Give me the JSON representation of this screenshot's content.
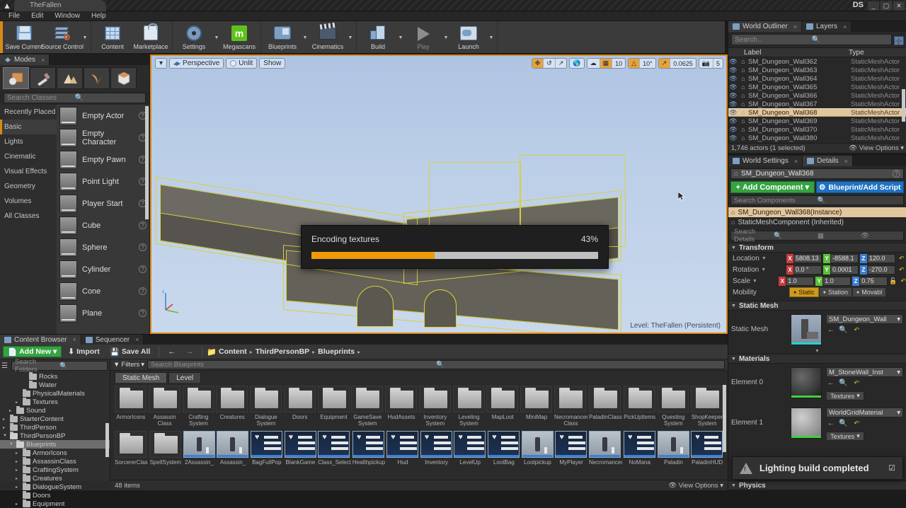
{
  "window": {
    "project_tab": "TheFallen",
    "ds_badge": "DS",
    "buttons": {
      "minimize": "_",
      "maximize": "▢",
      "close": "✕"
    }
  },
  "menubar": [
    "File",
    "Edit",
    "Window",
    "Help"
  ],
  "toolbar": {
    "groups": [
      {
        "items": [
          {
            "label": "Save Current",
            "icon": "save-icon",
            "caret": false
          },
          {
            "label": "Source Control",
            "icon": "source-control-icon",
            "caret": true
          }
        ]
      },
      {
        "items": [
          {
            "label": "Content",
            "icon": "content-icon",
            "caret": false
          },
          {
            "label": "Marketplace",
            "icon": "marketplace-icon",
            "caret": false
          }
        ]
      },
      {
        "items": [
          {
            "label": "Settings",
            "icon": "gear-icon",
            "caret": true
          },
          {
            "label": "Megascans",
            "icon": "megascans-icon",
            "caret": false
          }
        ]
      },
      {
        "items": [
          {
            "label": "Blueprints",
            "icon": "blueprints-icon",
            "caret": true
          },
          {
            "label": "Cinematics",
            "icon": "cinematics-icon",
            "caret": true
          }
        ]
      },
      {
        "items": [
          {
            "label": "Build",
            "icon": "build-icon",
            "caret": true
          },
          {
            "label": "Play",
            "icon": "play-icon",
            "caret": true,
            "disabled": true
          },
          {
            "label": "Launch",
            "icon": "launch-icon",
            "caret": true
          }
        ]
      }
    ]
  },
  "modes": {
    "tab_label": "Modes",
    "close_label": "×",
    "mode_buttons": [
      "place-mode-icon",
      "paint-mode-icon",
      "landscape-mode-icon",
      "foliage-mode-icon",
      "geometry-editing-icon"
    ],
    "search_placeholder": "Search Classes",
    "categories": [
      {
        "label": "Recently Placed",
        "selected": false
      },
      {
        "label": "Basic",
        "selected": true
      },
      {
        "label": "Lights",
        "selected": false
      },
      {
        "label": "Cinematic",
        "selected": false
      },
      {
        "label": "Visual Effects",
        "selected": false
      },
      {
        "label": "Geometry",
        "selected": false
      },
      {
        "label": "Volumes",
        "selected": false
      },
      {
        "label": "All Classes",
        "selected": false
      }
    ],
    "items": [
      {
        "label": "Empty Actor"
      },
      {
        "label": "Empty Character"
      },
      {
        "label": "Empty Pawn"
      },
      {
        "label": "Point Light"
      },
      {
        "label": "Player Start"
      },
      {
        "label": "Cube"
      },
      {
        "label": "Sphere"
      },
      {
        "label": "Cylinder"
      },
      {
        "label": "Cone"
      },
      {
        "label": "Plane"
      }
    ]
  },
  "viewport": {
    "menu_caret": "▾",
    "perspective": "Perspective",
    "view_mode": "Unlit",
    "show": "Show",
    "level_label": "Level:  TheFallen (Persistent)",
    "transform_tools": [
      "translate-tool-icon",
      "rotate-tool-icon",
      "scale-tool-icon"
    ],
    "coord_icon": "world-coordinate-icon",
    "surface_snap_icon": "surface-snap-icon",
    "grid_snap_icon": "grid-snap-icon",
    "grid_snap_value": "10",
    "rotation_snap_icon": "rotation-snap-icon",
    "rotation_snap_value": "10°",
    "scale_snap_icon": "scale-snap-icon",
    "scale_snap_value": "0.0625",
    "camera_speed_icon": "camera-speed-icon",
    "camera_speed_value": "5"
  },
  "progress": {
    "title": "Encoding textures",
    "percent_label": "43%",
    "percent": 43,
    "fill_color": "#f09a0a",
    "track_color": "#c0c0c0"
  },
  "outliner": {
    "tabs": [
      {
        "label": "World Outliner",
        "icon": "outliner-icon",
        "active": true
      },
      {
        "label": "Layers",
        "icon": "layers-icon",
        "active": false
      }
    ],
    "search_placeholder": "Search...",
    "add_button_icon": "add-outliner-icon",
    "columns": [
      "Label",
      "Type"
    ],
    "sort_indicator": "▲",
    "rows": [
      {
        "label": "SM_Dungeon_Wall362",
        "type": "StaticMeshActor",
        "selected": false
      },
      {
        "label": "SM_Dungeon_Wall363",
        "type": "StaticMeshActor",
        "selected": false
      },
      {
        "label": "SM_Dungeon_Wall364",
        "type": "StaticMeshActor",
        "selected": false
      },
      {
        "label": "SM_Dungeon_Wall365",
        "type": "StaticMeshActor",
        "selected": false
      },
      {
        "label": "SM_Dungeon_Wall366",
        "type": "StaticMeshActor",
        "selected": false
      },
      {
        "label": "SM_Dungeon_Wall367",
        "type": "StaticMeshActor",
        "selected": false
      },
      {
        "label": "SM_Dungeon_Wall368",
        "type": "StaticMeshActor",
        "selected": true
      },
      {
        "label": "SM_Dungeon_Wall369",
        "type": "StaticMeshActor",
        "selected": false
      },
      {
        "label": "SM_Dungeon_Wall370",
        "type": "StaticMeshActor",
        "selected": false
      },
      {
        "label": "SM_Dungeon_Wall380",
        "type": "StaticMeshActor",
        "selected": false
      }
    ],
    "status": "1,746 actors (1 selected)",
    "view_options": "View Options"
  },
  "details": {
    "tabs": [
      {
        "label": "World Settings",
        "icon": "world-settings-icon",
        "active": false
      },
      {
        "label": "Details",
        "icon": "details-icon",
        "active": true
      }
    ],
    "actor_name": "SM_Dungeon_Wall368",
    "add_component_label": "Add Component",
    "add_component_plus": "+",
    "add_component_caret": "▾",
    "blueprint_label": "Blueprint/Add Script",
    "components_search_placeholder": "Search Components",
    "components": [
      {
        "label": "SM_Dungeon_Wall368(Instance)",
        "selected": true
      },
      {
        "label": "StaticMeshComponent (Inherited)",
        "selected": false
      }
    ],
    "details_search_placeholder": "Search Details",
    "transform": {
      "section": "Transform",
      "rows": [
        {
          "label": "Location",
          "x": "5808.13",
          "y": "-8588.1",
          "z": "120.0"
        },
        {
          "label": "Rotation",
          "x": "0.0 °",
          "y": "0.0001",
          "z": "-270.0"
        },
        {
          "label": "Scale",
          "x": "1.0",
          "y": "1.0",
          "z": "0.75"
        }
      ],
      "mobility_label": "Mobility",
      "mobility_options": [
        {
          "label": "Static",
          "selected": true
        },
        {
          "label": "Station",
          "selected": false
        },
        {
          "label": "Movabl",
          "selected": false
        }
      ]
    },
    "static_mesh": {
      "section": "Static Mesh",
      "label": "Static Mesh",
      "value": "SM_Dungeon_Wall"
    },
    "materials": {
      "section": "Materials",
      "elements": [
        {
          "label": "Element 0",
          "value": "M_StoneWall_Inst",
          "textures_label": "Textures"
        },
        {
          "label": "Element 1",
          "value": "WorldGridMaterial",
          "textures_label": "Textures"
        }
      ]
    },
    "physics_section": "Physics",
    "lighting_toast": {
      "message": "Lighting build completed",
      "icon": "warning-icon",
      "check": "☑"
    }
  },
  "content_browser": {
    "tabs": [
      {
        "label": "Content Browser",
        "icon": "content-browser-icon",
        "active": true
      },
      {
        "label": "Sequencer",
        "icon": "sequencer-icon",
        "active": false
      }
    ],
    "add_new_label": "Add New",
    "add_new_caret": "▾",
    "import_label": "Import",
    "save_all_label": "Save All",
    "nav_back": "←",
    "nav_forward": "→",
    "breadcrumb": [
      "Content",
      "ThirdPersonBP",
      "Blueprints"
    ],
    "tree_search_placeholder": "Search Folders",
    "filters_label": "Filters",
    "asset_search_placeholder": "Search Blueprints",
    "sub_tabs": [
      {
        "label": "Static Mesh",
        "active": true
      },
      {
        "label": "Level",
        "active": false
      }
    ],
    "tree": [
      {
        "label": "Rocks",
        "depth": 3,
        "expandable": false,
        "selected": false
      },
      {
        "label": "Water",
        "depth": 3,
        "expandable": false,
        "selected": false
      },
      {
        "label": "PhysicalMaterials",
        "depth": 2,
        "expandable": false,
        "selected": false
      },
      {
        "label": "Textures",
        "depth": 2,
        "expandable": true,
        "selected": false
      },
      {
        "label": "Sound",
        "depth": 1,
        "expandable": true,
        "selected": false
      },
      {
        "label": "StarterContent",
        "depth": 0,
        "expandable": true,
        "selected": false
      },
      {
        "label": "ThirdPerson",
        "depth": 0,
        "expandable": true,
        "selected": false
      },
      {
        "label": "ThirdPersonBP",
        "depth": 0,
        "expandable": true,
        "expanded": true,
        "selected": false
      },
      {
        "label": "Blueprints",
        "depth": 1,
        "expandable": true,
        "expanded": true,
        "selected": true
      },
      {
        "label": "ArmorIcons",
        "depth": 2,
        "expandable": true,
        "selected": false
      },
      {
        "label": "AssassinClass",
        "depth": 2,
        "expandable": true,
        "selected": false
      },
      {
        "label": "CraftingSystem",
        "depth": 2,
        "expandable": true,
        "selected": false
      },
      {
        "label": "Creatures",
        "depth": 2,
        "expandable": true,
        "selected": false
      },
      {
        "label": "DialogueSystem",
        "depth": 2,
        "expandable": true,
        "selected": false
      },
      {
        "label": "Doors",
        "depth": 2,
        "expandable": false,
        "selected": false
      },
      {
        "label": "Equipment",
        "depth": 2,
        "expandable": true,
        "selected": false
      }
    ],
    "assets_row1": [
      {
        "label": "ArmorIcons",
        "kind": "folder"
      },
      {
        "label": "Assassin Class",
        "kind": "folder"
      },
      {
        "label": "Crafting System",
        "kind": "folder"
      },
      {
        "label": "Creatures",
        "kind": "folder"
      },
      {
        "label": "Dialogue System",
        "kind": "folder"
      },
      {
        "label": "Doors",
        "kind": "folder"
      },
      {
        "label": "Equipment",
        "kind": "folder"
      },
      {
        "label": "GameSave System",
        "kind": "folder"
      },
      {
        "label": "HudAssets",
        "kind": "folder"
      },
      {
        "label": "Inventory System",
        "kind": "folder"
      },
      {
        "label": "Leveling System",
        "kind": "folder"
      },
      {
        "label": "MapLoot",
        "kind": "folder"
      },
      {
        "label": "MiniMap",
        "kind": "folder"
      },
      {
        "label": "Necromancer Class",
        "kind": "folder"
      },
      {
        "label": "PaladinClass",
        "kind": "folder"
      },
      {
        "label": "PickUpItems",
        "kind": "folder"
      },
      {
        "label": "Questing System",
        "kind": "folder"
      },
      {
        "label": "ShopKeeper System",
        "kind": "folder"
      }
    ],
    "assets_row2": [
      {
        "label": "SorcererClass",
        "kind": "folder"
      },
      {
        "label": "SpellSystem",
        "kind": "folder"
      },
      {
        "label": "2Assassin_",
        "kind": "mesh"
      },
      {
        "label": "Assassin_",
        "kind": "mesh"
      },
      {
        "label": "BagFullPop",
        "kind": "blueprint"
      },
      {
        "label": "BlankGame",
        "kind": "blueprint"
      },
      {
        "label": "Class_Select",
        "kind": "blueprint"
      },
      {
        "label": "Healthpickup",
        "kind": "blueprint"
      },
      {
        "label": "Hud",
        "kind": "blueprint"
      },
      {
        "label": "Inventory",
        "kind": "blueprint"
      },
      {
        "label": "LevelUp",
        "kind": "blueprint"
      },
      {
        "label": "LootBag",
        "kind": "blueprint"
      },
      {
        "label": "Lootpickup",
        "kind": "mesh"
      },
      {
        "label": "MyPlayer",
        "kind": "blueprint"
      },
      {
        "label": "Necromancer",
        "kind": "mesh"
      },
      {
        "label": "NoMana",
        "kind": "blueprint"
      },
      {
        "label": "Paladin",
        "kind": "mesh"
      },
      {
        "label": "PaladinHUD",
        "kind": "blueprint"
      }
    ],
    "item_count": "48 items",
    "view_options": "View Options"
  }
}
